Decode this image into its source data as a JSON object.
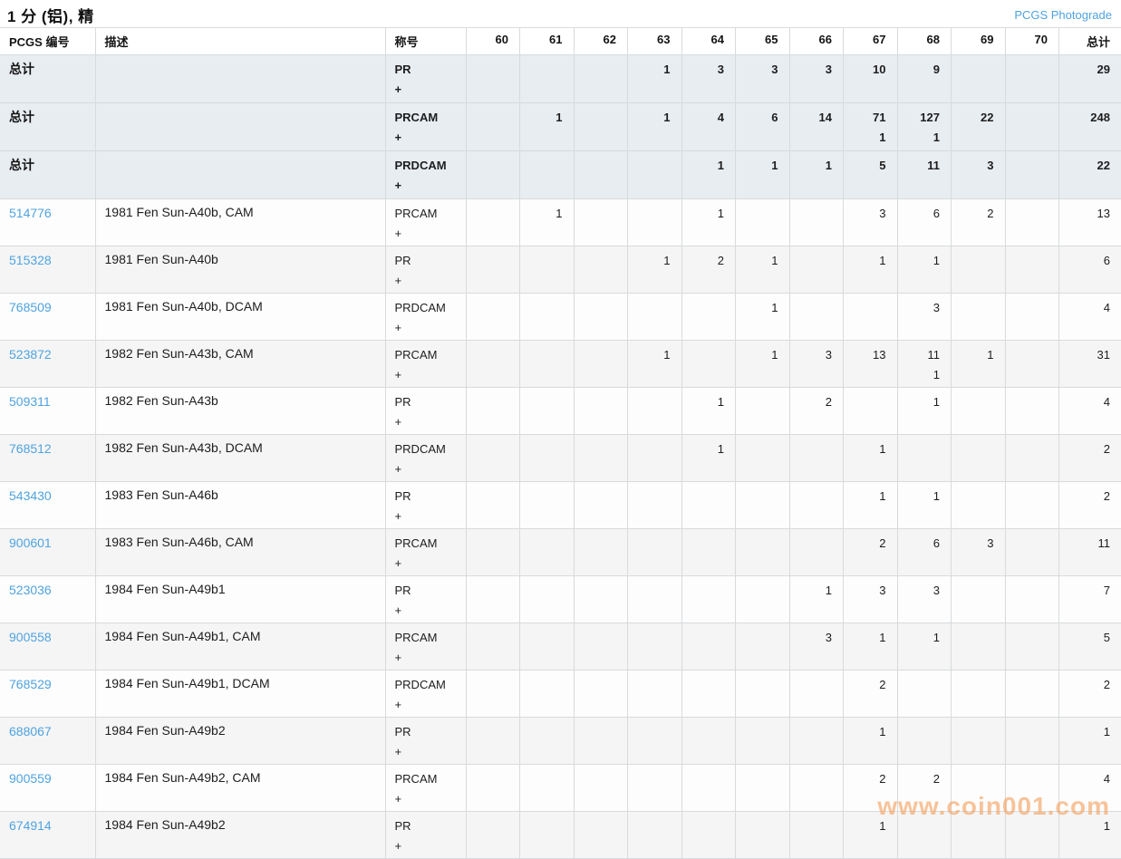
{
  "header": {
    "title": "1 分 (铝), 精",
    "photograde_link_label": "PCGS Photograde"
  },
  "colors": {
    "link_blue": "#4fa3e0",
    "total_row_bg": "#e8edf2",
    "alt_row_bg": "#f5f5f5",
    "watermark_orange": "#f3a669"
  },
  "watermark": {
    "text": "www.coin001.com"
  },
  "table": {
    "columns": [
      "PCGS 编号",
      "描述",
      "称号",
      "60",
      "61",
      "62",
      "63",
      "64",
      "65",
      "66",
      "67",
      "68",
      "69",
      "70",
      "总计"
    ],
    "grade_columns": [
      "60",
      "61",
      "62",
      "63",
      "64",
      "65",
      "66",
      "67",
      "68",
      "69",
      "70"
    ],
    "rows": [
      {
        "pcgs_no": "总计",
        "is_total": true,
        "description": "",
        "designation": "PR",
        "plus_sign": "+",
        "values": [
          "",
          "",
          "",
          "1",
          "3",
          "3",
          "3",
          "10",
          "9",
          "",
          ""
        ],
        "total": "29",
        "total_plus": ""
      },
      {
        "pcgs_no": "总计",
        "is_total": true,
        "description": "",
        "designation": "PRCAM",
        "plus_sign": "+",
        "values": [
          "",
          "1",
          "",
          "1",
          "4",
          "6",
          "14",
          "71",
          "127",
          "22",
          ""
        ],
        "plus_values": [
          "",
          "",
          "",
          "",
          "",
          "",
          "",
          "1",
          "1",
          "",
          ""
        ],
        "total": "248",
        "total_plus": ""
      },
      {
        "pcgs_no": "总计",
        "is_total": true,
        "description": "",
        "designation": "PRDCAM",
        "plus_sign": "+",
        "values": [
          "",
          "",
          "",
          "",
          "1",
          "1",
          "1",
          "5",
          "11",
          "3",
          ""
        ],
        "total": "22",
        "total_plus": ""
      },
      {
        "pcgs_no": "514776",
        "is_total": false,
        "description": "1981 Fen Sun-A40b, CAM",
        "designation": "PRCAM",
        "plus_sign": "+",
        "values": [
          "",
          "1",
          "",
          "",
          "1",
          "",
          "",
          "3",
          "6",
          "2",
          ""
        ],
        "total": "13",
        "total_plus": ""
      },
      {
        "pcgs_no": "515328",
        "is_total": false,
        "description": "1981 Fen Sun-A40b",
        "designation": "PR",
        "plus_sign": "+",
        "values": [
          "",
          "",
          "",
          "1",
          "2",
          "1",
          "",
          "1",
          "1",
          "",
          ""
        ],
        "total": "6",
        "total_plus": ""
      },
      {
        "pcgs_no": "768509",
        "is_total": false,
        "description": "1981 Fen Sun-A40b, DCAM",
        "designation": "PRDCAM",
        "plus_sign": "+",
        "values": [
          "",
          "",
          "",
          "",
          "",
          "1",
          "",
          "",
          "3",
          "",
          ""
        ],
        "total": "4",
        "total_plus": ""
      },
      {
        "pcgs_no": "523872",
        "is_total": false,
        "description": "1982 Fen Sun-A43b, CAM",
        "designation": "PRCAM",
        "plus_sign": "+",
        "values": [
          "",
          "",
          "",
          "1",
          "",
          "1",
          "3",
          "13",
          "11",
          "1",
          ""
        ],
        "plus_values": [
          "",
          "",
          "",
          "",
          "",
          "",
          "",
          "",
          "1",
          "",
          ""
        ],
        "total": "31",
        "total_plus": ""
      },
      {
        "pcgs_no": "509311",
        "is_total": false,
        "description": "1982 Fen Sun-A43b",
        "designation": "PR",
        "plus_sign": "+",
        "values": [
          "",
          "",
          "",
          "",
          "1",
          "",
          "2",
          "",
          "1",
          "",
          ""
        ],
        "total": "4",
        "total_plus": ""
      },
      {
        "pcgs_no": "768512",
        "is_total": false,
        "description": "1982 Fen Sun-A43b, DCAM",
        "designation": "PRDCAM",
        "plus_sign": "+",
        "values": [
          "",
          "",
          "",
          "",
          "1",
          "",
          "",
          "1",
          "",
          "",
          ""
        ],
        "total": "2",
        "total_plus": ""
      },
      {
        "pcgs_no": "543430",
        "is_total": false,
        "description": "1983 Fen Sun-A46b",
        "designation": "PR",
        "plus_sign": "+",
        "values": [
          "",
          "",
          "",
          "",
          "",
          "",
          "",
          "1",
          "1",
          "",
          ""
        ],
        "total": "2",
        "total_plus": ""
      },
      {
        "pcgs_no": "900601",
        "is_total": false,
        "description": "1983 Fen Sun-A46b, CAM",
        "designation": "PRCAM",
        "plus_sign": "+",
        "values": [
          "",
          "",
          "",
          "",
          "",
          "",
          "",
          "2",
          "6",
          "3",
          ""
        ],
        "total": "11",
        "total_plus": ""
      },
      {
        "pcgs_no": "523036",
        "is_total": false,
        "description": "1984 Fen Sun-A49b1",
        "designation": "PR",
        "plus_sign": "+",
        "values": [
          "",
          "",
          "",
          "",
          "",
          "",
          "1",
          "3",
          "3",
          "",
          ""
        ],
        "total": "7",
        "total_plus": ""
      },
      {
        "pcgs_no": "900558",
        "is_total": false,
        "description": "1984 Fen Sun-A49b1, CAM",
        "designation": "PRCAM",
        "plus_sign": "+",
        "values": [
          "",
          "",
          "",
          "",
          "",
          "",
          "3",
          "1",
          "1",
          "",
          ""
        ],
        "total": "5",
        "total_plus": ""
      },
      {
        "pcgs_no": "768529",
        "is_total": false,
        "description": "1984 Fen Sun-A49b1, DCAM",
        "designation": "PRDCAM",
        "plus_sign": "+",
        "values": [
          "",
          "",
          "",
          "",
          "",
          "",
          "",
          "2",
          "",
          "",
          ""
        ],
        "total": "2",
        "total_plus": ""
      },
      {
        "pcgs_no": "688067",
        "is_total": false,
        "description": "1984 Fen Sun-A49b2",
        "designation": "PR",
        "plus_sign": "+",
        "values": [
          "",
          "",
          "",
          "",
          "",
          "",
          "",
          "1",
          "",
          "",
          ""
        ],
        "total": "1",
        "total_plus": ""
      },
      {
        "pcgs_no": "900559",
        "is_total": false,
        "description": "1984 Fen Sun-A49b2, CAM",
        "designation": "PRCAM",
        "plus_sign": "+",
        "values": [
          "",
          "",
          "",
          "",
          "",
          "",
          "",
          "2",
          "2",
          "",
          ""
        ],
        "total": "4",
        "total_plus": ""
      },
      {
        "pcgs_no": "674914",
        "is_total": false,
        "description": "1984 Fen Sun-A49b2",
        "designation": "PR",
        "plus_sign": "+",
        "values": [
          "",
          "",
          "",
          "",
          "",
          "",
          "",
          "1",
          "",
          "",
          ""
        ],
        "total": "1",
        "total_plus": ""
      }
    ]
  }
}
